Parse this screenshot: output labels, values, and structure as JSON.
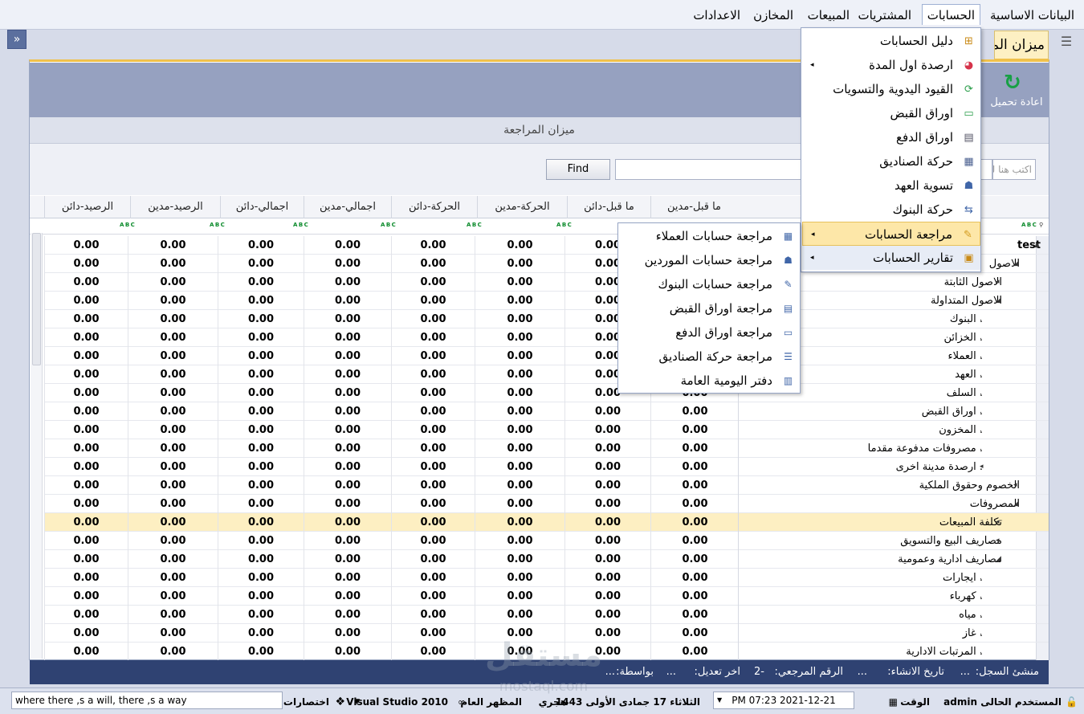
{
  "menubar": {
    "items": [
      "البيانات الاساسية",
      "الحسابات",
      "المشتريات",
      "المبيعات",
      "المخازن",
      "الاعدادات"
    ]
  },
  "window": {
    "doc_tab": "ميزان المراجعة",
    "reload_label": "اعادة تحميل",
    "grid_caption": "ميزان المراجعة",
    "search_placeholder": "اكتب هنا للبحث",
    "find_label": "Find"
  },
  "columns": [
    "ما قبل-مدين",
    "ما قبل-دائن",
    "الحركة-مدين",
    "الحركة-دائن",
    "اجمالي-مدين",
    "اجمالي-دائن",
    "الرصيد-مدين",
    "الرصيد-دائن"
  ],
  "filter_badge": "A B C",
  "rows": [
    {
      "name": "test",
      "level": 0,
      "exp": "▲"
    },
    {
      "name": "الاصول",
      "level": 1,
      "exp": "◢"
    },
    {
      "name": "الاصول الثابتة",
      "level": 2,
      "exp": "◂"
    },
    {
      "name": "الاصول المتداولة",
      "level": 2,
      "exp": "◢"
    },
    {
      "name": ". البنوك",
      "level": 3,
      "exp": "."
    },
    {
      "name": ". الخزائن",
      "level": 3,
      "exp": "."
    },
    {
      "name": ". العملاء",
      "level": 3,
      "exp": "."
    },
    {
      "name": ". العهد",
      "level": 3,
      "exp": "."
    },
    {
      "name": ". السلف",
      "level": 3,
      "exp": "."
    },
    {
      "name": ". اوراق القبض",
      "level": 3,
      "exp": "."
    },
    {
      "name": ". المخزون",
      "level": 3,
      "exp": "."
    },
    {
      "name": ". مصروفات مدفوعة مقدما",
      "level": 3,
      "exp": "."
    },
    {
      "name": ". ارصدة مدينة اخرى",
      "level": 3,
      "exp": "◂"
    },
    {
      "name": "الخصوم وحقوق الملكية",
      "level": 1,
      "exp": "◂"
    },
    {
      "name": "المصروفات",
      "level": 1,
      "exp": "◢"
    },
    {
      "name": "تكلفة المبيعات",
      "level": 2,
      "exp": "◂"
    },
    {
      "name": "مصاريف البيع والتسويق",
      "level": 2,
      "exp": "◂"
    },
    {
      "name": "مصاريف ادارية وعمومية",
      "level": 2,
      "exp": "◢"
    },
    {
      "name": ". ايجارات",
      "level": 3,
      "exp": "."
    },
    {
      "name": ". كهرباء",
      "level": 3,
      "exp": "."
    },
    {
      "name": ". مياه",
      "level": 3,
      "exp": "."
    },
    {
      "name": ". غاز",
      "level": 3,
      "exp": "."
    },
    {
      "name": ". المرتبات الادارية",
      "level": 3,
      "exp": "."
    }
  ],
  "cell_value": "0.00",
  "selected_row_index": 15,
  "dropdown": {
    "items": [
      {
        "label": "دليل الحسابات",
        "icon": "tree-icon",
        "arrow": false
      },
      {
        "label": "ارصدة اول المدة",
        "icon": "pie-icon",
        "arrow": true
      },
      {
        "label": "القيود اليدوية والتسويات",
        "icon": "refresh-gear-icon",
        "arrow": false
      },
      {
        "label": "اوراق القبض",
        "icon": "cash-icon",
        "arrow": false
      },
      {
        "label": "اوراق الدفع",
        "icon": "card-icon",
        "arrow": false
      },
      {
        "label": "حركة الصناديق",
        "icon": "grid-icon",
        "arrow": false
      },
      {
        "label": "تسوية العهد",
        "icon": "user-doc-icon",
        "arrow": false
      },
      {
        "label": "حركة البنوك",
        "icon": "transfer-icon",
        "arrow": false
      },
      {
        "label": "مراجعة الحسابات",
        "icon": "edit-icon",
        "arrow": true
      },
      {
        "label": "تقارير الحسابات",
        "icon": "clipboard-icon",
        "arrow": true
      }
    ],
    "highlighted_index": 8,
    "hover_index": 9
  },
  "submenu": {
    "items": [
      {
        "label": "مراجعة حسابات العملاء",
        "icon": "table-icon"
      },
      {
        "label": "مراجعة حسابات الموردين",
        "icon": "user-table-icon"
      },
      {
        "label": "مراجعة حسابات البنوك",
        "icon": "bank-icon"
      },
      {
        "label": "مراجعة اوراق القبض",
        "icon": "doc-icon"
      },
      {
        "label": "مراجعة اوراق الدفع",
        "icon": "form-icon"
      },
      {
        "label": "مراجعة حركة الصناديق",
        "icon": "list-icon"
      },
      {
        "label": "دفتر اليومية العامة",
        "icon": "ledger-icon"
      }
    ]
  },
  "record_bar": {
    "creator_label": "منشئ السجل:",
    "creator_value": "...",
    "created_label": "تاريخ الانشاء:",
    "created_value": "...",
    "ref_label": "الرقم المرجعي:",
    "ref_value": "-2",
    "modified_label": "اخر تعديل:",
    "modified_value": "...",
    "by_label": "بواسطة:",
    "by_value": "..."
  },
  "statusbar": {
    "current_user_label": "المستخدم الحالى",
    "current_user": "admin",
    "time_label": "الوقت",
    "datetime": "PM 07:23 2021-12-21",
    "hijri_date": "الثلاثاء 17 جمادى الأولى 1443",
    "hijri_label": "هجري",
    "theme_label": "المظهر العام",
    "theme_value": "Visual Studio 2010",
    "shortcuts_label": "اختصارات",
    "motto": "where there ,s a will, there ,s a way"
  },
  "watermark": {
    "text": "مستقل",
    "sub": "mostaql.com"
  }
}
